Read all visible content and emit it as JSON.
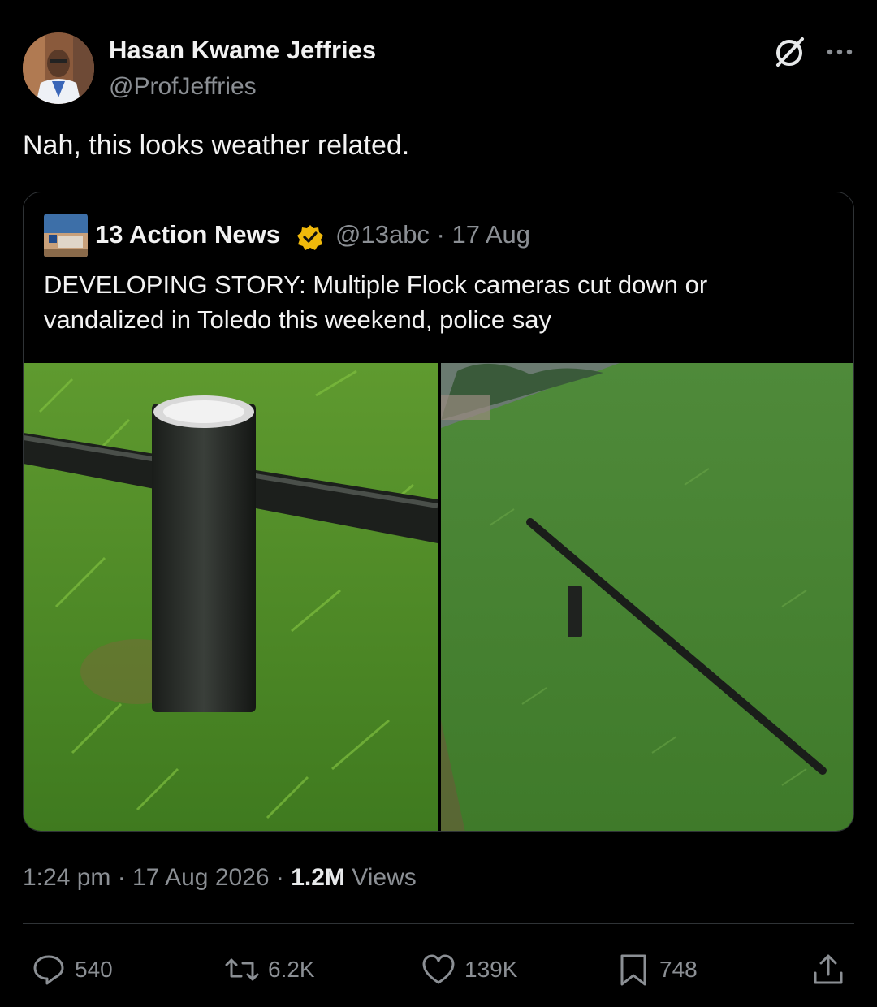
{
  "author": {
    "name": "Hasan Kwame Jeffries",
    "handle": "@ProfJeffries"
  },
  "icons": {
    "grok": "grok-icon",
    "more": "more-options-icon",
    "verified": "verified-badge-icon",
    "reply": "reply-icon",
    "repost": "repost-icon",
    "like": "heart-icon",
    "bookmark": "bookmark-icon",
    "share": "share-icon"
  },
  "tweet": {
    "text": "Nah, this looks weather related."
  },
  "quoted": {
    "name": "13 Action News",
    "meta": "@13abc · 17 Aug",
    "text": "DEVELOPING STORY: Multiple Flock cameras cut down or vandalized in Toledo this weekend, police say",
    "badge_color": "#f0b90b"
  },
  "timestamp": {
    "time_date": "1:24 pm · 17 Aug 2026 · ",
    "views_count": "1.2M",
    "views_label": " Views"
  },
  "actions": {
    "replies": "540",
    "reposts": "6.2K",
    "likes": "139K",
    "bookmarks": "748"
  }
}
